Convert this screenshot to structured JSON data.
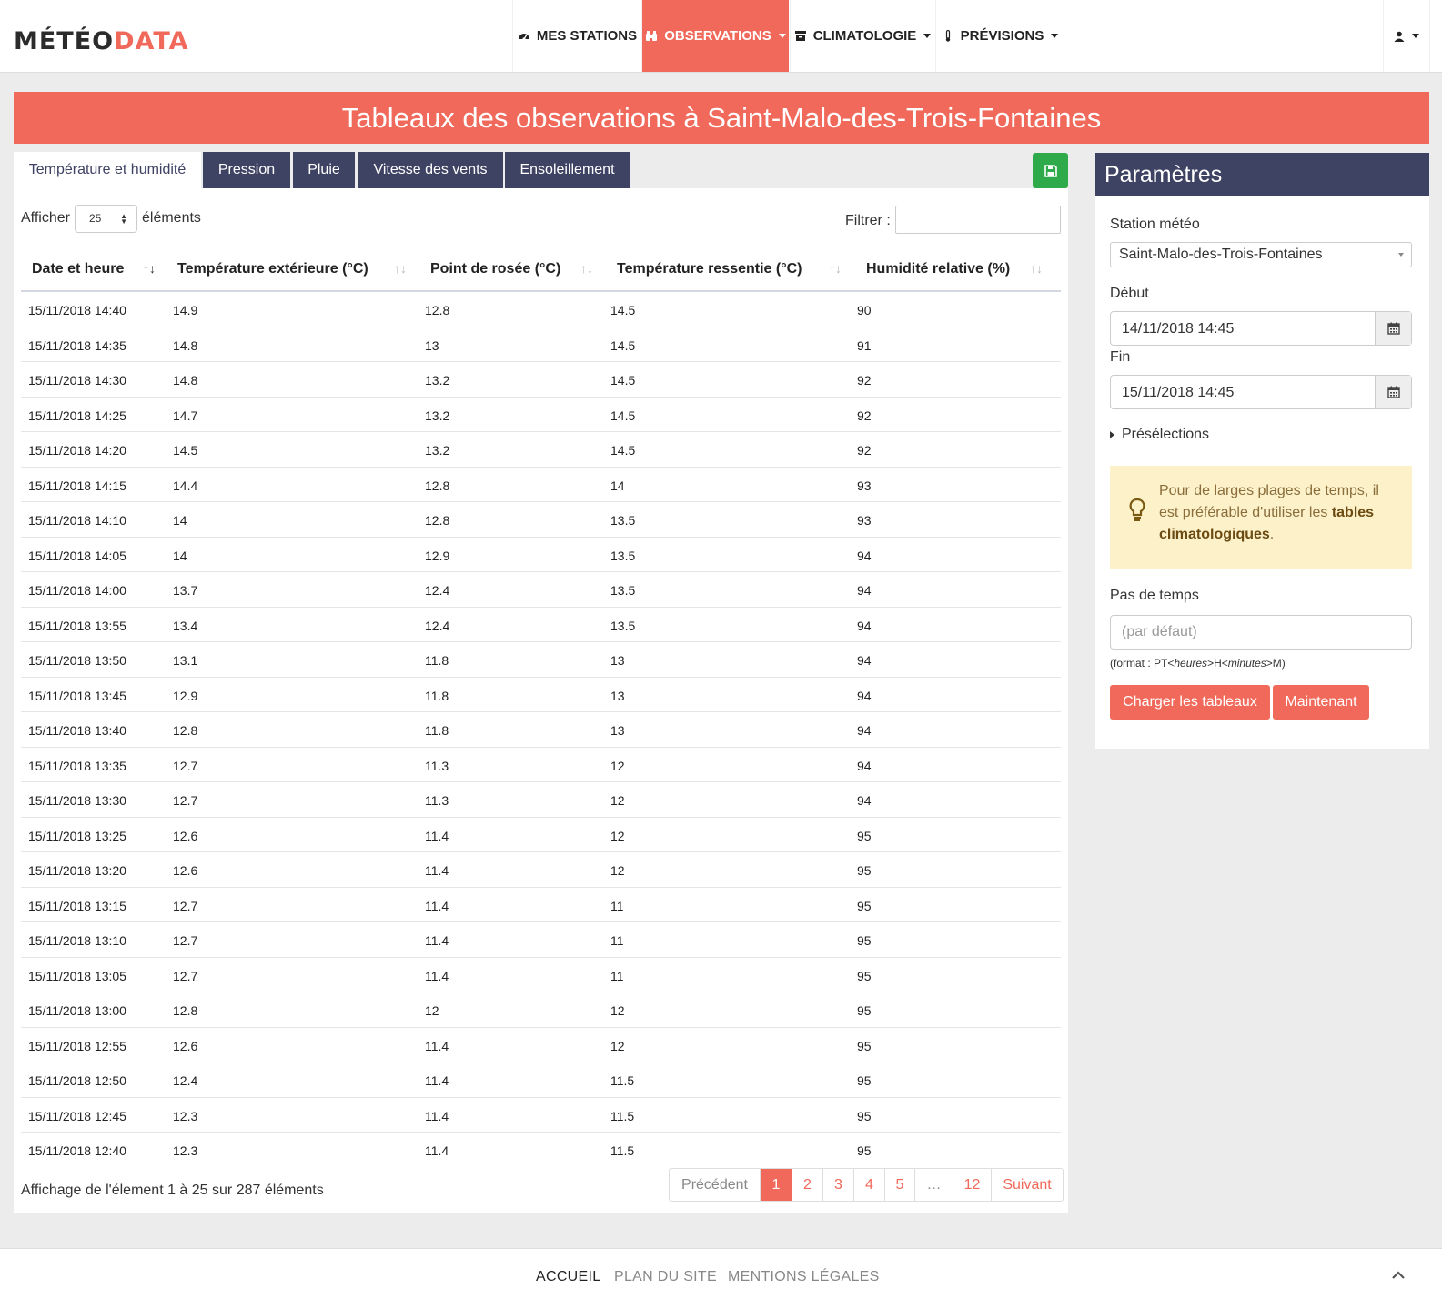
{
  "brand": {
    "part1": "MÉTÉO",
    "part2": "DATA"
  },
  "nav": {
    "items": [
      {
        "label": "MES STATIONS",
        "icon": "dashboard-icon"
      },
      {
        "label": "OBSERVATIONS",
        "icon": "binoculars-icon"
      },
      {
        "label": "CLIMATOLOGIE",
        "icon": "archive-icon"
      },
      {
        "label": "PRÉVISIONS",
        "icon": "thermometer-icon"
      }
    ],
    "active": "OBSERVATIONS",
    "user_icon": "user-icon"
  },
  "page_title": "Tableaux des observations à Saint-Malo-des-Trois-Fontaines",
  "tabs": [
    "Température et humidité",
    "Pression",
    "Pluie",
    "Vitesse des vents",
    "Ensoleillement"
  ],
  "table_controls": {
    "show_label": "Afficher",
    "page_length": "25",
    "elements_label": "éléments",
    "filter_label": "Filtrer :"
  },
  "table": {
    "columns": [
      "Date et heure",
      "Température extérieure (°C)",
      "Point de rosée (°C)",
      "Température ressentie (°C)",
      "Humidité relative (%)"
    ],
    "rows": [
      [
        "15/11/2018 14:40",
        "14.9",
        "12.8",
        "14.5",
        "90"
      ],
      [
        "15/11/2018 14:35",
        "14.8",
        "13",
        "14.5",
        "91"
      ],
      [
        "15/11/2018 14:30",
        "14.8",
        "13.2",
        "14.5",
        "92"
      ],
      [
        "15/11/2018 14:25",
        "14.7",
        "13.2",
        "14.5",
        "92"
      ],
      [
        "15/11/2018 14:20",
        "14.5",
        "13.2",
        "14.5",
        "92"
      ],
      [
        "15/11/2018 14:15",
        "14.4",
        "12.8",
        "14",
        "93"
      ],
      [
        "15/11/2018 14:10",
        "14",
        "12.8",
        "13.5",
        "93"
      ],
      [
        "15/11/2018 14:05",
        "14",
        "12.9",
        "13.5",
        "94"
      ],
      [
        "15/11/2018 14:00",
        "13.7",
        "12.4",
        "13.5",
        "94"
      ],
      [
        "15/11/2018 13:55",
        "13.4",
        "12.4",
        "13.5",
        "94"
      ],
      [
        "15/11/2018 13:50",
        "13.1",
        "11.8",
        "13",
        "94"
      ],
      [
        "15/11/2018 13:45",
        "12.9",
        "11.8",
        "13",
        "94"
      ],
      [
        "15/11/2018 13:40",
        "12.8",
        "11.8",
        "13",
        "94"
      ],
      [
        "15/11/2018 13:35",
        "12.7",
        "11.3",
        "12",
        "94"
      ],
      [
        "15/11/2018 13:30",
        "12.7",
        "11.3",
        "12",
        "94"
      ],
      [
        "15/11/2018 13:25",
        "12.6",
        "11.4",
        "12",
        "95"
      ],
      [
        "15/11/2018 13:20",
        "12.6",
        "11.4",
        "12",
        "95"
      ],
      [
        "15/11/2018 13:15",
        "12.7",
        "11.4",
        "11",
        "95"
      ],
      [
        "15/11/2018 13:10",
        "12.7",
        "11.4",
        "11",
        "95"
      ],
      [
        "15/11/2018 13:05",
        "12.7",
        "11.4",
        "11",
        "95"
      ],
      [
        "15/11/2018 13:00",
        "12.8",
        "12",
        "12",
        "95"
      ],
      [
        "15/11/2018 12:55",
        "12.6",
        "11.4",
        "12",
        "95"
      ],
      [
        "15/11/2018 12:50",
        "12.4",
        "11.4",
        "11.5",
        "95"
      ],
      [
        "15/11/2018 12:45",
        "12.3",
        "11.4",
        "11.5",
        "95"
      ],
      [
        "15/11/2018 12:40",
        "12.3",
        "11.4",
        "11.5",
        "95"
      ]
    ],
    "info": "Affichage de l'élement 1 à 25 sur 287 éléments"
  },
  "pagination": {
    "prev": "Précédent",
    "pages": [
      "1",
      "2",
      "3",
      "4",
      "5",
      "…",
      "12"
    ],
    "current": "1",
    "next": "Suivant"
  },
  "sidebar": {
    "title": "Paramètres",
    "station_label": "Station météo",
    "station_value": "Saint-Malo-des-Trois-Fontaines",
    "start_label": "Début",
    "start_value": "14/11/2018 14:45",
    "end_label": "Fin",
    "end_value": "15/11/2018 14:45",
    "presets_label": "Présélections",
    "alert_text": "Pour de larges plages de temps, il est préférable d'utiliser les ",
    "alert_bold": "tables climatologiques",
    "alert_end": ".",
    "step_label": "Pas de temps",
    "step_placeholder": "(par défaut)",
    "step_help_prefix": "(format : PT<",
    "step_help_hours": "heures",
    "step_help_mid": ">H<",
    "step_help_minutes": "minutes",
    "step_help_suffix": ">M)",
    "load_button": "Charger les tableaux",
    "now_button": "Maintenant"
  },
  "footer": {
    "links": [
      "ACCUEIL",
      "PLAN DU SITE",
      "MENTIONS LÉGALES"
    ]
  },
  "colors": {
    "accent": "#f0695a",
    "dark": "#3e4263",
    "success": "#2faa4b",
    "alert_bg": "#fcf1c9"
  }
}
